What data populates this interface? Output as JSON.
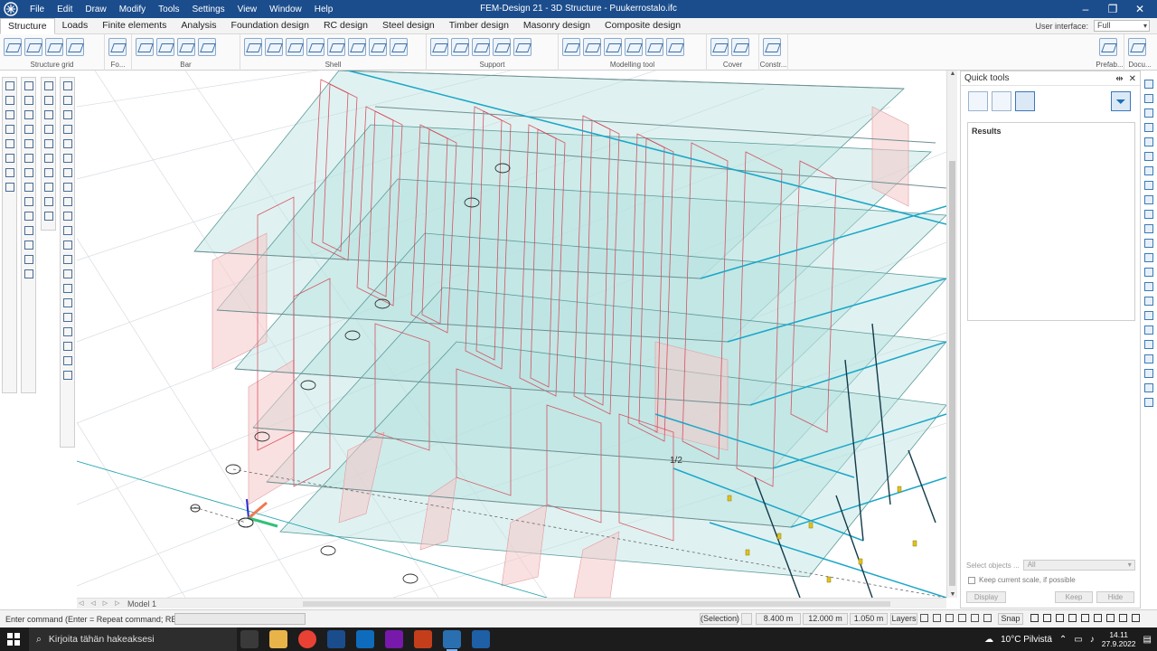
{
  "titlebar": {
    "menu": [
      "File",
      "Edit",
      "Draw",
      "Modify",
      "Tools",
      "Settings",
      "View",
      "Window",
      "Help"
    ],
    "title": "FEM-Design 21 - 3D Structure - Puukerrostalo.ifc"
  },
  "ribbon_tabs": {
    "tabs": [
      "Structure",
      "Loads",
      "Finite elements",
      "Analysis",
      "Foundation design",
      "RC design",
      "Steel design",
      "Timber design",
      "Masonry design",
      "Composite design"
    ],
    "active": "Structure",
    "user_interface_label": "User interface:",
    "user_interface_value": "Full"
  },
  "ribbon_groups": [
    "Structure grid",
    "Fo...",
    "Bar",
    "Shell",
    "Support",
    "Modelling tool",
    "Cover",
    "Constr...",
    "Prefab...",
    "Docu..."
  ],
  "viewport": {
    "model_tab": "Model 1",
    "marker": "1/2"
  },
  "quick_tools": {
    "title": "Quick tools",
    "results_label": "Results",
    "select_objects_label": "Select objects ...",
    "select_objects_value": "All",
    "keep_scale_label": "Keep current scale, if possible",
    "display_button": "Display",
    "keep_button": "Keep",
    "hide_button": "Hide"
  },
  "statusbar": {
    "command_prompt": "Enter command (Enter = Repeat command; RB = Modify):",
    "selection": "(Selection)",
    "x": "8.400 m",
    "y": "12.000 m",
    "z": "1.050 m",
    "layers": "Layers",
    "snap": "Snap"
  },
  "taskbar": {
    "search_placeholder": "Kirjoita tähän hakeaksesi",
    "weather": "10°C  Pilvistä",
    "time": "14.11",
    "date": "27.9.2022"
  },
  "colors": {
    "titlebar": "#1b4d8c",
    "slab_fill": "#b9e3df",
    "wall_fill": "#f6c9c9",
    "wall_line": "#d6394b",
    "beam_cyan": "#1aa6c8"
  }
}
